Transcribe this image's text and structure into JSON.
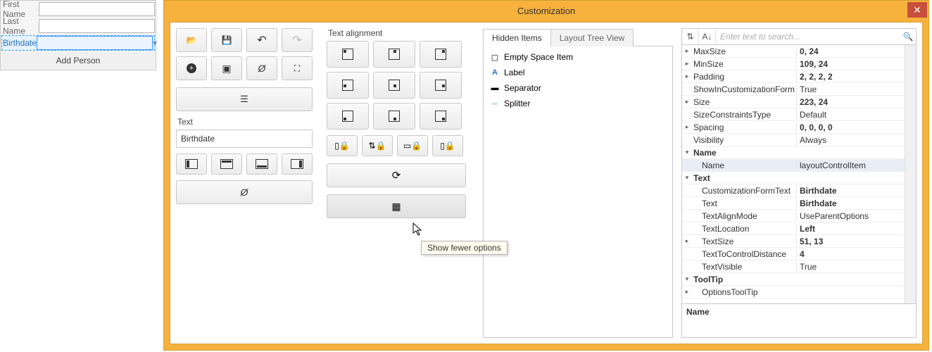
{
  "form": {
    "fields": [
      {
        "label": "First Name",
        "value": ""
      },
      {
        "label": "Last Name",
        "value": ""
      },
      {
        "label": "Birthdate",
        "value": ""
      }
    ],
    "add_button": "Add Person"
  },
  "window": {
    "title": "Customization",
    "text_section_label": "Text",
    "text_value": "Birthdate",
    "align_section_label": "Text alignment",
    "tabs": {
      "hidden": "Hidden Items",
      "tree": "Layout Tree View"
    },
    "hidden_items": [
      {
        "icon": "empty-space-icon",
        "label": "Empty Space Item"
      },
      {
        "icon": "label-icon",
        "label": "Label"
      },
      {
        "icon": "separator-icon",
        "label": "Separator"
      },
      {
        "icon": "splitter-icon",
        "label": "Splitter"
      }
    ],
    "search_placeholder": "Enter text to search...",
    "properties": [
      {
        "exp": "▸",
        "name": "MaxSize",
        "val": "0, 24",
        "bold": true
      },
      {
        "exp": "▸",
        "name": "MinSize",
        "val": "109, 24",
        "bold": true
      },
      {
        "exp": "▸",
        "name": "Padding",
        "val": "2, 2, 2, 2",
        "bold": true
      },
      {
        "exp": "",
        "name": "ShowInCustomizationForm",
        "val": "True"
      },
      {
        "exp": "▸",
        "name": "Size",
        "val": "223, 24",
        "bold": true
      },
      {
        "exp": "",
        "name": "SizeConstraintsType",
        "val": "Default"
      },
      {
        "exp": "▸",
        "name": "Spacing",
        "val": "0, 0, 0, 0",
        "bold": true
      },
      {
        "exp": "",
        "name": "Visibility",
        "val": "Always"
      },
      {
        "group": true,
        "exp": "▾",
        "name": "Name"
      },
      {
        "indent": true,
        "sel": true,
        "name": "Name",
        "val": "layoutControlItem"
      },
      {
        "group": true,
        "exp": "▾",
        "name": "Text"
      },
      {
        "indent": true,
        "name": "CustomizationFormText",
        "val": "Birthdate",
        "bold": true
      },
      {
        "indent": true,
        "name": "Text",
        "val": "Birthdate",
        "bold": true
      },
      {
        "indent": true,
        "name": "TextAlignMode",
        "val": "UseParentOptions"
      },
      {
        "indent": true,
        "name": "TextLocation",
        "val": "Left",
        "bold": true
      },
      {
        "exp": "▸",
        "indent": true,
        "name": "TextSize",
        "val": "51, 13",
        "bold": true
      },
      {
        "indent": true,
        "name": "TextToControlDistance",
        "val": "4",
        "bold": true
      },
      {
        "indent": true,
        "name": "TextVisible",
        "val": "True"
      },
      {
        "group": true,
        "exp": "▾",
        "name": "ToolTip"
      },
      {
        "exp": "▸",
        "indent": true,
        "name": "OptionsToolTip",
        "val": ""
      }
    ],
    "footer_label": "Name",
    "tooltip": "Show fewer options"
  }
}
